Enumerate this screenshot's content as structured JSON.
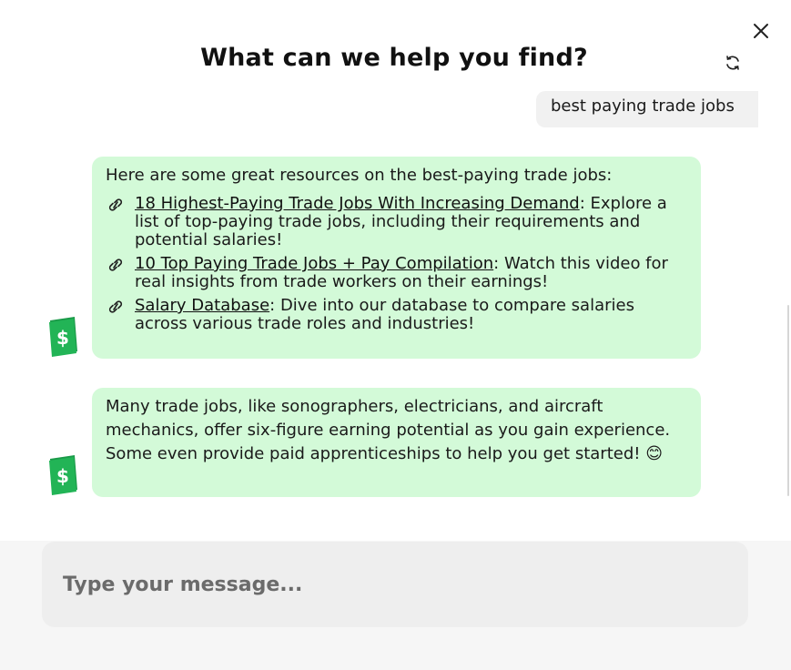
{
  "header": {
    "title": "What can we help you find?",
    "close_icon": "close-icon",
    "refresh_icon": "refresh-icon"
  },
  "conversation": {
    "user_message": "best paying trade jobs",
    "bot_messages": [
      {
        "intro": "Here are some great resources on the best-paying trade jobs:",
        "resources": [
          {
            "link_text": "18 Highest-Paying Trade Jobs With Increasing Demand",
            "description": ": Explore a list of top-paying trade jobs, including their requirements and potential salaries!"
          },
          {
            "link_text": "10 Top Paying Trade Jobs + Pay Compilation",
            "description": ": Watch this video for real insights from trade workers on their earnings!"
          },
          {
            "link_text": "Salary Database",
            "description": ": Dive into our database to compare salaries across various trade roles and industries!"
          }
        ]
      },
      {
        "text": "Many trade jobs, like sonographers, electricians, and aircraft mechanics, offer six-figure earning potential as you gain experience. Some even provide paid apprenticeships to help you get started! 😊"
      }
    ],
    "bot_avatar_icon": "dollar-bill-icon"
  },
  "composer": {
    "placeholder": "Type your message..."
  },
  "colors": {
    "bot_bubble": "#d3fad8",
    "user_bubble": "#f1f1f1",
    "avatar_green": "#22b456",
    "input_bg": "#eeeeee"
  }
}
